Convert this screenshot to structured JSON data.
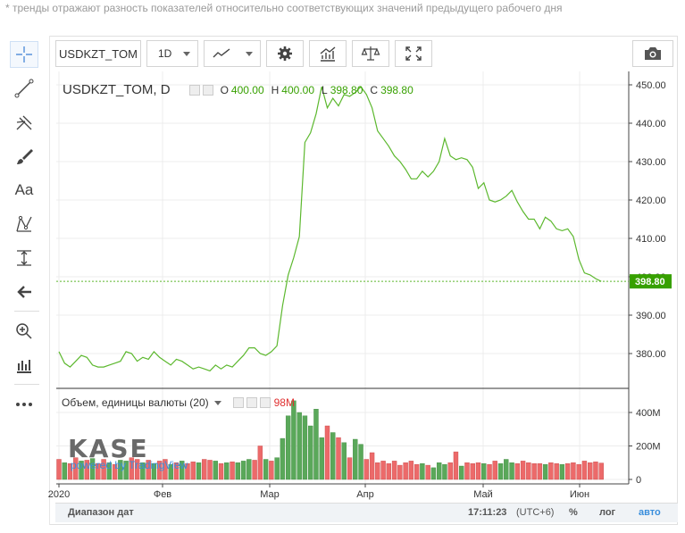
{
  "note": "* тренды отражают разность показателей относительно соответствующих значений предыдущего рабочего дня",
  "toolbar": {
    "symbol": "USDKZT_TOM",
    "interval": "1D",
    "icons": [
      "line-style-icon",
      "gear-icon",
      "indicators-icon",
      "compare-icon",
      "fullscreen-icon",
      "camera-icon"
    ]
  },
  "left_tools": [
    "crosshair-icon",
    "trend-line-icon",
    "pitchfork-icon",
    "brush-icon",
    "text-icon",
    "pattern-icon",
    "measure-icon",
    "back-arrow-icon",
    "zoom-icon",
    "bar-replay-icon",
    "more-icon"
  ],
  "text_tool_label": "Aa",
  "legend": {
    "symbol": "USDKZT_TOM, D",
    "o_label": "O",
    "o": "400.00",
    "h_label": "H",
    "h": "400.00",
    "l_label": "L",
    "l": "398.80",
    "c_label": "C",
    "c": "398.80"
  },
  "volume_legend": {
    "label": "Объем, единицы валюты (20)",
    "value": "98M"
  },
  "bottom": {
    "range_label": "Диапазон дат",
    "time": "17:11:23",
    "tz": "(UTC+6)",
    "percent": "%",
    "log": "лог",
    "auto": "авто"
  },
  "logo": {
    "name": "KASE",
    "powered": "powered by TradingView"
  },
  "colors": {
    "line": "#5cb82e",
    "up": "#5aa85a",
    "down": "#ec6a6a",
    "last_label": "#37a000"
  },
  "chart_data": [
    {
      "type": "line",
      "series": [
        {
          "name": "USDKZT_TOM",
          "values": [
            380.5,
            377.5,
            376.5,
            378.0,
            379.5,
            379.0,
            377.0,
            376.5,
            376.5,
            377.0,
            377.5,
            378.0,
            380.5,
            380.0,
            378.0,
            379.0,
            378.5,
            380.5,
            379.0,
            378.0,
            377.0,
            378.5,
            378.0,
            377.0,
            376.0,
            376.5,
            376.0,
            375.5,
            377.0,
            376.0,
            377.0,
            376.5,
            378.0,
            379.5,
            381.5,
            381.5,
            380.0,
            379.5,
            380.5,
            382.0,
            392.5,
            400.5,
            405.0,
            410.5,
            435.0,
            437.5,
            442.5,
            449.5,
            444.0,
            446.5,
            444.5,
            447.5,
            447.0,
            448.0,
            449.5,
            447.5,
            444.0,
            438.0,
            436.0,
            434.0,
            431.5,
            430.0,
            428.0,
            425.5,
            425.5,
            427.5,
            426.0,
            427.5,
            430.0,
            436.0,
            431.5,
            430.5,
            431.0,
            430.5,
            428.5,
            423.0,
            424.5,
            420.0,
            419.5,
            420.0,
            421.0,
            422.5,
            419.5,
            417.0,
            415.0,
            415.0,
            412.5,
            415.5,
            414.5,
            412.5,
            412.0,
            412.5,
            410.5,
            404.5,
            401.0,
            400.5,
            399.5,
            398.8
          ]
        }
      ],
      "last_value": "398.80",
      "y_ticks": [
        "380.00",
        "390.00",
        "400.00",
        "410.00",
        "420.00",
        "430.00",
        "440.00",
        "450.00"
      ],
      "ylim": [
        372,
        452
      ],
      "x_labels": [
        "2020",
        "Фев",
        "Мар",
        "Апр",
        "Май",
        "Июн"
      ]
    },
    {
      "type": "bar",
      "series": [
        {
          "name": "Объем, единицы валюты",
          "values": [
            120,
            100,
            95,
            130,
            110,
            115,
            125,
            95,
            120,
            100,
            90,
            115,
            110,
            130,
            120,
            100,
            115,
            95,
            110,
            120,
            90,
            100,
            110,
            95,
            105,
            100,
            120,
            115,
            110,
            95,
            100,
            105,
            100,
            110,
            120,
            115,
            200,
            120,
            110,
            130,
            245,
            380,
            470,
            400,
            380,
            320,
            420,
            250,
            320,
            280,
            250,
            220,
            130,
            240,
            210,
            120,
            160,
            100,
            110,
            95,
            110,
            85,
            100,
            110,
            90,
            95,
            85,
            70,
            100,
            90,
            100,
            165,
            80,
            100,
            95,
            100,
            95,
            90,
            110,
            95,
            120,
            100,
            95,
            110,
            100,
            95,
            95,
            90,
            100,
            95,
            90,
            95,
            100,
            90,
            110,
            100,
            105,
            98
          ],
          "directions": [
            "down",
            "up",
            "down",
            "down",
            "up",
            "down",
            "up",
            "down",
            "down",
            "up",
            "down",
            "up",
            "up",
            "down",
            "down",
            "up",
            "down",
            "up",
            "down",
            "down",
            "up",
            "down",
            "up",
            "down",
            "down",
            "up",
            "down",
            "down",
            "up",
            "down",
            "up",
            "down",
            "up",
            "up",
            "up",
            "down",
            "down",
            "up",
            "down",
            "up",
            "up",
            "up",
            "up",
            "up",
            "up",
            "up",
            "up",
            "up",
            "down",
            "up",
            "down",
            "up",
            "down",
            "up",
            "up",
            "down",
            "down",
            "down",
            "down",
            "down",
            "down",
            "down",
            "down",
            "down",
            "down",
            "up",
            "down",
            "up",
            "up",
            "up",
            "down",
            "down",
            "up",
            "down",
            "down",
            "down",
            "up",
            "down",
            "down",
            "up",
            "up",
            "up",
            "down",
            "down",
            "down",
            "down",
            "down",
            "up",
            "down",
            "down",
            "up",
            "down",
            "down",
            "down",
            "down",
            "down",
            "down",
            "down"
          ]
        }
      ],
      "y_ticks": [
        "0",
        "200M",
        "400M"
      ],
      "ylim": [
        0,
        500
      ]
    }
  ]
}
